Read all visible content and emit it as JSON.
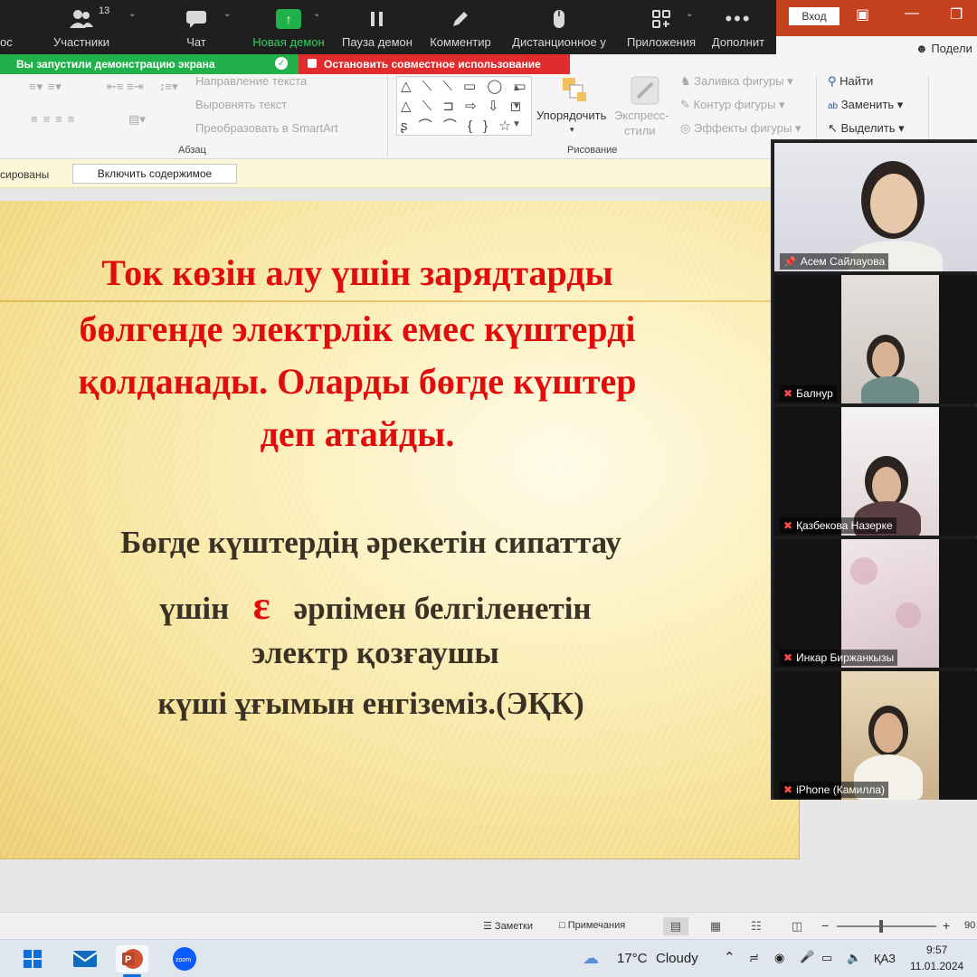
{
  "zoom": {
    "cut_left_label": "ос",
    "participants_count": "13",
    "buttons": {
      "participants": "Участники",
      "chat": "Чат",
      "new_share": "Новая демон",
      "pause_share": "Пауза демон",
      "annotate": "Комментир",
      "remote_control": "Дистанционное у",
      "apps": "Приложения",
      "more": "Дополнит"
    },
    "share_notice": "Вы запустили демонстрацию экрана",
    "stop_share": "Остановить совместное использование",
    "colors": {
      "toolbar_bg": "#1f1f1f",
      "green": "#21b14a",
      "red": "#e02c2c"
    }
  },
  "ppt": {
    "signin": "Вход",
    "share": "Подели",
    "ribbon": {
      "text_direction": "Направление текста",
      "align_text": "Выровнять текст",
      "convert_smartart": "Преобразовать в SmartArt",
      "paragraph_group": "Абзац",
      "arrange": "Упорядочить",
      "quick_styles_1": "Экспресс-",
      "quick_styles_2": "стили",
      "shape_fill": "Заливка фигуры",
      "shape_outline": "Контур фигуры",
      "shape_effects": "Эффекты фигуры",
      "drawing_group": "Рисование",
      "find": "Найти",
      "replace": "Заменить",
      "select": "Выделить"
    },
    "message_bar": {
      "text": "сированы",
      "enable_button": "Включить содержимое"
    },
    "slide": {
      "red_lines": [
        "Ток көзін алу үшін зарядтарды",
        "бөлгенде электрлік емес күштерді",
        "қолданады. Оларды бөгде күштер",
        "деп атайды."
      ],
      "dark_line_1": "Бөгде күштердің әрекетін сипаттау",
      "dark_line_2_pre": "үшін",
      "epsilon": "ɛ",
      "dark_line_2_post": "әрпімен белгіленетін",
      "dark_line_3": "электр қозғаушы",
      "dark_line_4": "күші ұғымын енгіземіз.(ЭҚК)",
      "colors": {
        "red": "#e10d0d",
        "dark": "#3b3226"
      }
    },
    "status_bar": {
      "notes": "Заметки",
      "comments": "Примечания",
      "zoom_percent": "90"
    }
  },
  "participants": [
    {
      "name": "Асем Сайлауова",
      "pinned": true,
      "muted": false
    },
    {
      "name": "Балнур",
      "pinned": false,
      "muted": true
    },
    {
      "name": "Қазбекова Назерке",
      "pinned": false,
      "muted": true
    },
    {
      "name": "Инкар Биржанкызы",
      "pinned": false,
      "muted": true
    },
    {
      "name": "iPhone (Камилла)",
      "pinned": false,
      "muted": true
    }
  ],
  "taskbar": {
    "weather_temp": "17°C",
    "weather_desc": "Cloudy",
    "language": "ҚАЗ",
    "time": "9:57",
    "date": "11.01.2024",
    "apps": [
      "start-icon",
      "mail-icon",
      "powerpoint-icon",
      "zoom-icon"
    ]
  }
}
